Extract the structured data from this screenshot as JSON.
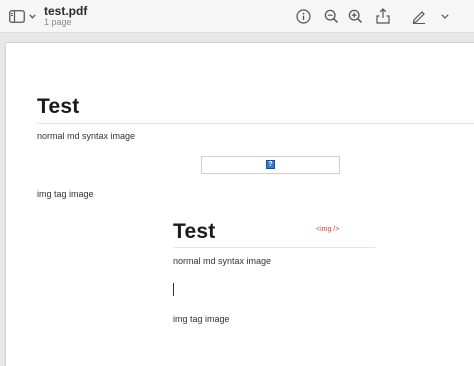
{
  "window": {
    "doc_title": "test.pdf",
    "doc_subtitle": "1 page"
  },
  "toolbar": {
    "icons": [
      "sidebar-icon",
      "chevron-down-icon",
      "info-icon",
      "zoom-out-icon",
      "zoom-in-icon",
      "share-icon",
      "markup-pen-icon",
      "chevron-down-icon"
    ]
  },
  "document": {
    "heading": "Test",
    "md_image_label": "normal md syntax image",
    "broken_image_glyph": "?",
    "img_tag_label": "img tag image",
    "embedded": {
      "heading": "Test",
      "alt_text": "<img />",
      "md_image_label": "normal md syntax image",
      "img_tag_label": "img tag image"
    }
  },
  "colors": {
    "alt_text": "#e23b3b",
    "broken_icon": "#2f7bd8"
  }
}
